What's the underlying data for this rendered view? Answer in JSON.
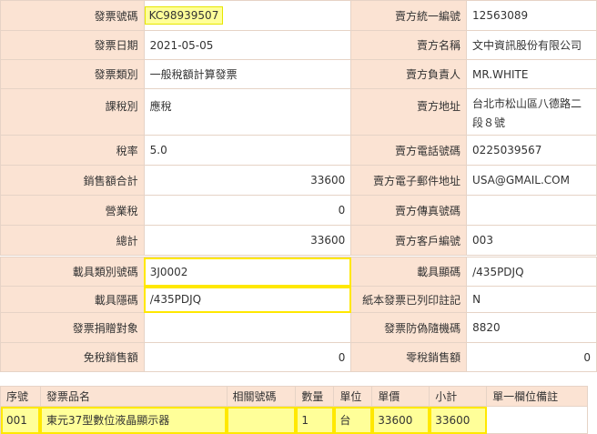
{
  "invoice": {
    "rows": [
      {
        "l1": "發票號碼",
        "v1": "KC98939507",
        "l2": "賣方統一編號",
        "v2": "12563089"
      },
      {
        "l1": "發票日期",
        "v1": "2021-05-05",
        "l2": "賣方名稱",
        "v2": "文中資訊股份有限公司"
      },
      {
        "l1": "發票類別",
        "v1": "一般稅額計算發票",
        "l2": "賣方負責人",
        "v2": "MR.WHITE"
      },
      {
        "l1": "課稅別",
        "v1": "應稅",
        "l2": "賣方地址",
        "v2": "台北市松山區八德路二段８號"
      },
      {
        "l1": "稅率",
        "v1": "5.0",
        "l2": "賣方電話號碼",
        "v2": "0225039567"
      },
      {
        "l1": "銷售額合計",
        "v1": "33600",
        "l2": "賣方電子郵件地址",
        "v2": "USA@GMAIL.COM"
      },
      {
        "l1": "營業稅",
        "v1": "0",
        "l2": "賣方傳真號碼",
        "v2": ""
      },
      {
        "l1": "總計",
        "v1": "33600",
        "l2": "賣方客戶編號",
        "v2": "003"
      }
    ]
  },
  "carrier": {
    "rows": [
      {
        "l1": "載具類別號碼",
        "v1": "3J0002",
        "l2": "載具顯碼",
        "v2": "/435PDJQ"
      },
      {
        "l1": "載具隱碼",
        "v1": "/435PDJQ",
        "l2": "紙本發票已列印註記",
        "v2": "N"
      },
      {
        "l1": "發票捐贈對象",
        "v1": "",
        "l2": "發票防偽隨機碼",
        "v2": "8820"
      },
      {
        "l1": "免稅銷售額",
        "v1": "0",
        "l2": "零稅銷售額",
        "v2": "0"
      }
    ]
  },
  "items": {
    "headers": [
      "序號",
      "發票品名",
      "相關號碼",
      "數量",
      "單位",
      "單價",
      "小計",
      "單一欄位備註"
    ],
    "rows": [
      {
        "seq": "001",
        "name": "東元37型數位液晶顯示器",
        "ref": "",
        "qty": "1",
        "unit": "台",
        "price": "33600",
        "subtotal": "33600",
        "note": ""
      }
    ]
  },
  "colors": {
    "label_bg": "#fbe3d3",
    "border": "#e6d3c6",
    "highlight": "#ffff99",
    "highlight_border": "#ffe800"
  }
}
